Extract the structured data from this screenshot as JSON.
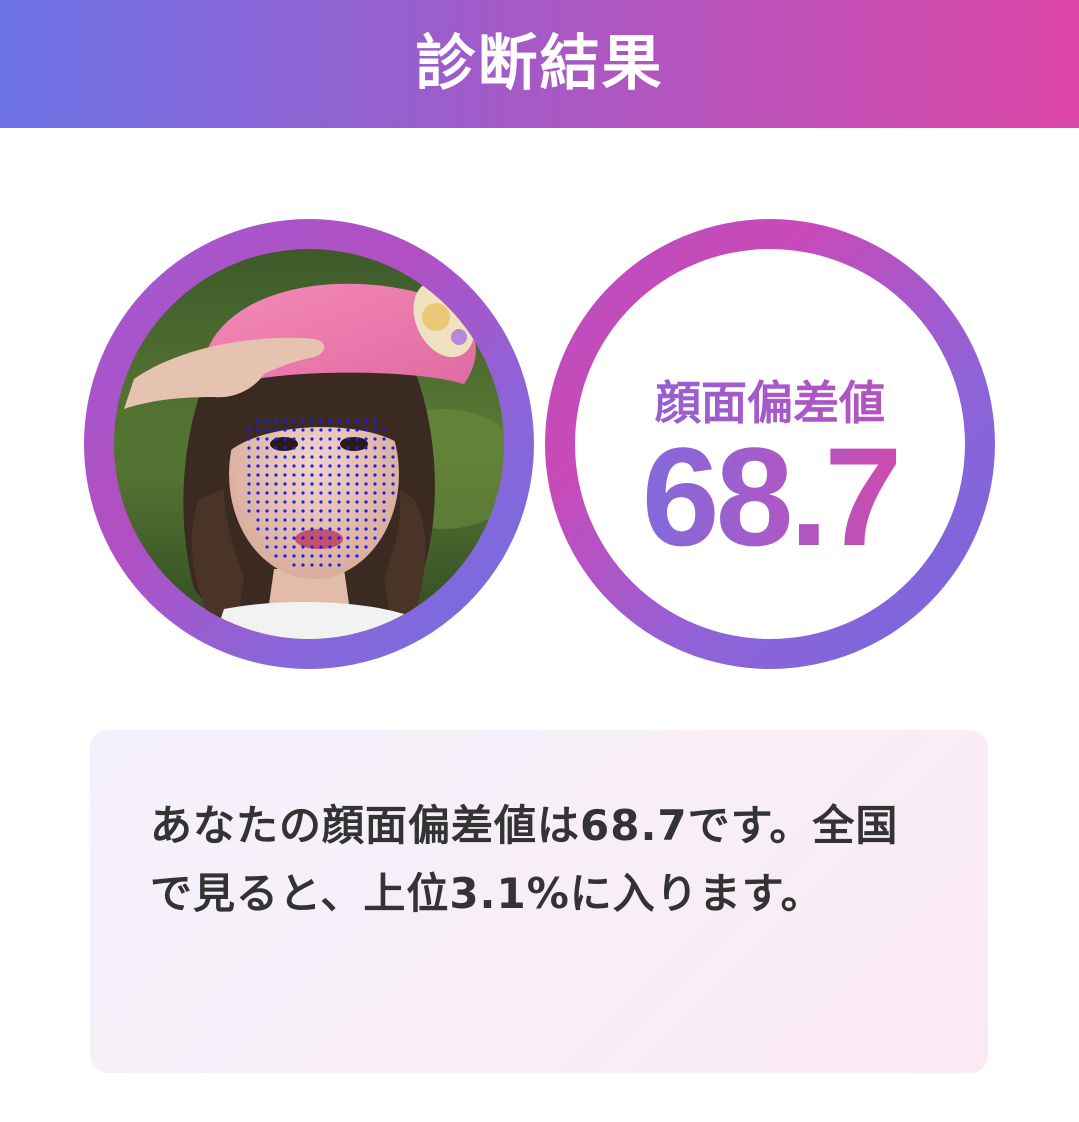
{
  "header": {
    "title": "診断結果"
  },
  "photo": {
    "icon": "face-landmark-photo"
  },
  "score": {
    "label": "顔面偏差値",
    "value": "68.7"
  },
  "result": {
    "text": "あなたの顔面偏差値は68.7です。全国で見ると、上位3.1%に入ります。"
  },
  "colors": {
    "gradient_start": "#6b72e6",
    "gradient_mid": "#a15bc9",
    "gradient_end": "#dd46a6",
    "landmark_dots": "#1a1aff"
  }
}
